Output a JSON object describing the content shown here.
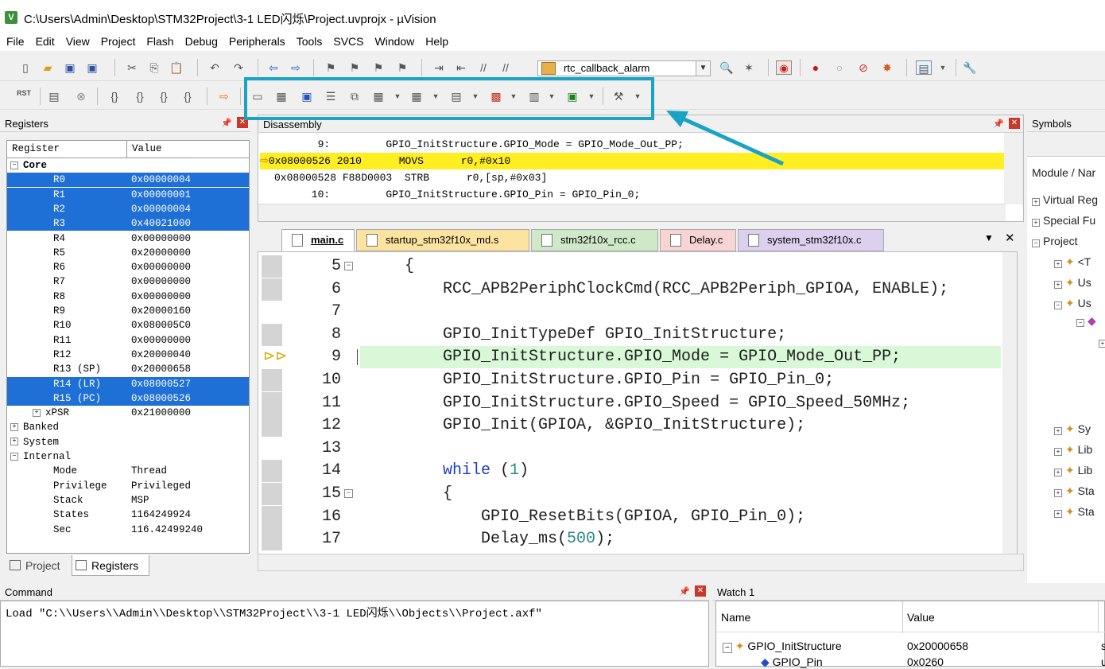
{
  "window": {
    "title": "C:\\Users\\Admin\\Desktop\\STM32Project\\3-1 LED闪烁\\Project.uvprojx - µVision",
    "icon_label": "V"
  },
  "menu": [
    "File",
    "Edit",
    "View",
    "Project",
    "Flash",
    "Debug",
    "Peripherals",
    "Tools",
    "SVCS",
    "Window",
    "Help"
  ],
  "toolbar": {
    "target_combo": "rtc_callback_alarm",
    "rst_label": "RST"
  },
  "registers": {
    "title": "Registers",
    "col_register": "Register",
    "col_value": "Value",
    "rows": [
      {
        "name": "Core",
        "value": "",
        "indent": 0,
        "group": true,
        "bold": true,
        "sel": false
      },
      {
        "name": "R0",
        "value": "0x00000004",
        "indent": 2,
        "sel": true
      },
      {
        "name": "R1",
        "value": "0x00000001",
        "indent": 2,
        "sel": true
      },
      {
        "name": "R2",
        "value": "0x00000004",
        "indent": 2,
        "sel": true
      },
      {
        "name": "R3",
        "value": "0x40021000",
        "indent": 2,
        "sel": true
      },
      {
        "name": "R4",
        "value": "0x00000000",
        "indent": 2,
        "sel": false
      },
      {
        "name": "R5",
        "value": "0x20000000",
        "indent": 2,
        "sel": false
      },
      {
        "name": "R6",
        "value": "0x00000000",
        "indent": 2,
        "sel": false
      },
      {
        "name": "R7",
        "value": "0x00000000",
        "indent": 2,
        "sel": false
      },
      {
        "name": "R8",
        "value": "0x00000000",
        "indent": 2,
        "sel": false
      },
      {
        "name": "R9",
        "value": "0x20000160",
        "indent": 2,
        "sel": false
      },
      {
        "name": "R10",
        "value": "0x080005C0",
        "indent": 2,
        "sel": false
      },
      {
        "name": "R11",
        "value": "0x00000000",
        "indent": 2,
        "sel": false
      },
      {
        "name": "R12",
        "value": "0x20000040",
        "indent": 2,
        "sel": false
      },
      {
        "name": "R13 (SP)",
        "value": "0x20000658",
        "indent": 2,
        "sel": false
      },
      {
        "name": "R14 (LR)",
        "value": "0x08000527",
        "indent": 2,
        "sel": true
      },
      {
        "name": "R15 (PC)",
        "value": "0x08000526",
        "indent": 2,
        "sel": true
      },
      {
        "name": "xPSR",
        "value": "0x21000000",
        "indent": 2,
        "group": true,
        "sel": false
      },
      {
        "name": "Banked",
        "value": "",
        "indent": 0,
        "group": true,
        "sel": false
      },
      {
        "name": "System",
        "value": "",
        "indent": 0,
        "group": true,
        "sel": false
      },
      {
        "name": "Internal",
        "value": "",
        "indent": 0,
        "group": true,
        "sel": false
      },
      {
        "name": "Mode",
        "value": "Thread",
        "indent": 2,
        "sel": false
      },
      {
        "name": "Privilege",
        "value": "Privileged",
        "indent": 2,
        "sel": false
      },
      {
        "name": "Stack",
        "value": "MSP",
        "indent": 2,
        "sel": false
      },
      {
        "name": "States",
        "value": "1164249924",
        "indent": 2,
        "sel": false
      },
      {
        "name": "Sec",
        "value": "116.42499240",
        "indent": 2,
        "sel": false
      }
    ],
    "tab_project": "Project",
    "tab_registers": "Registers"
  },
  "disassembly": {
    "title": "Disassembly",
    "lines": [
      {
        "text": "       9:         GPIO_InitStructure.GPIO_Mode = GPIO_Mode_Out_PP;",
        "cur": false
      },
      {
        "text": "0x08000526 2010      MOVS      r0,#0x10",
        "cur": true
      },
      {
        "text": "0x08000528 F88D0003  STRB      r0,[sp,#0x03]",
        "cur": false
      },
      {
        "text": "      10:         GPIO_InitStructure.GPIO_Pin = GPIO_Pin_0;",
        "cur": false
      }
    ]
  },
  "file_tabs": [
    {
      "label": "main.c",
      "color": "#f0f0f0",
      "active": true
    },
    {
      "label": "startup_stm32f10x_md.s",
      "color": "#fde3a0",
      "active": false
    },
    {
      "label": "stm32f10x_rcc.c",
      "color": "#cfe8c8",
      "active": false
    },
    {
      "label": "Delay.c",
      "color": "#f8d4d4",
      "active": false
    },
    {
      "label": "system_stm32f10x.c",
      "color": "#dcd0ef",
      "active": false
    }
  ],
  "editor": {
    "lines": [
      {
        "n": "5",
        "code": "{",
        "fold": true,
        "hl": false,
        "gray": true
      },
      {
        "n": "6",
        "code": "    RCC_APB2PeriphClockCmd(RCC_APB2Periph_GPIOA, ENABLE);",
        "fold": false,
        "hl": false,
        "gray": true
      },
      {
        "n": "7",
        "code": "",
        "fold": false,
        "hl": false,
        "gray": false
      },
      {
        "n": "8",
        "code": "    GPIO_InitTypeDef GPIO_InitStructure;",
        "fold": false,
        "hl": false,
        "gray": true
      },
      {
        "n": "9",
        "code": "    GPIO_InitStructure.GPIO_Mode = GPIO_Mode_Out_PP;",
        "fold": false,
        "hl": true,
        "gray": false
      },
      {
        "n": "10",
        "code": "    GPIO_InitStructure.GPIO_Pin = GPIO_Pin_0;",
        "fold": false,
        "hl": false,
        "gray": true
      },
      {
        "n": "11",
        "code": "    GPIO_InitStructure.GPIO_Speed = GPIO_Speed_50MHz;",
        "fold": false,
        "hl": false,
        "gray": true
      },
      {
        "n": "12",
        "code": "    GPIO_Init(GPIOA, &GPIO_InitStructure);",
        "fold": false,
        "hl": false,
        "gray": true
      },
      {
        "n": "13",
        "code": "",
        "fold": false,
        "hl": false,
        "gray": false
      },
      {
        "n": "14",
        "code": "    while (1)",
        "fold": false,
        "hl": false,
        "gray": true
      },
      {
        "n": "15",
        "code": "    {",
        "fold": true,
        "hl": false,
        "gray": true
      },
      {
        "n": "16",
        "code": "        GPIO_ResetBits(GPIOA, GPIO_Pin_0);",
        "fold": false,
        "hl": false,
        "gray": true
      },
      {
        "n": "17",
        "code": "        Delay_ms(500);",
        "fold": false,
        "hl": false,
        "gray": true
      }
    ]
  },
  "symbols": {
    "title": "Symbols",
    "col_header": "Module / Nar",
    "items": [
      {
        "label": "Virtual Reg",
        "indent": 0
      },
      {
        "label": "Special Fu",
        "indent": 0
      },
      {
        "label": "Project",
        "indent": 0
      },
      {
        "label": "<T",
        "indent": 1
      },
      {
        "label": "Us",
        "indent": 1
      },
      {
        "label": "Us",
        "indent": 1
      },
      {
        "label": "",
        "indent": 2
      },
      {
        "label": "",
        "indent": 3
      },
      {
        "label": "Sy",
        "indent": 1
      },
      {
        "label": "Lib",
        "indent": 1
      },
      {
        "label": "Lib",
        "indent": 1
      },
      {
        "label": "Sta",
        "indent": 1
      },
      {
        "label": "Sta",
        "indent": 1
      }
    ]
  },
  "command": {
    "title": "Command",
    "text": "Load \"C:\\\\Users\\\\Admin\\\\Desktop\\\\STM32Project\\\\3-1 LED闪烁\\\\Objects\\\\Project.axf\""
  },
  "watch": {
    "title": "Watch 1",
    "col_name": "Name",
    "col_value": "Value",
    "rows": [
      {
        "name": "GPIO_InitStructure",
        "value": "0x20000658",
        "extra": "s"
      },
      {
        "name": "GPIO_Pin",
        "value": "0x0260",
        "extra": "u"
      }
    ]
  },
  "colors": {
    "selection": "#1e6fd6",
    "current_line": "#ffee22",
    "highlight_box": "#1ba3c6",
    "cursor_line": "#d8f8d8"
  }
}
